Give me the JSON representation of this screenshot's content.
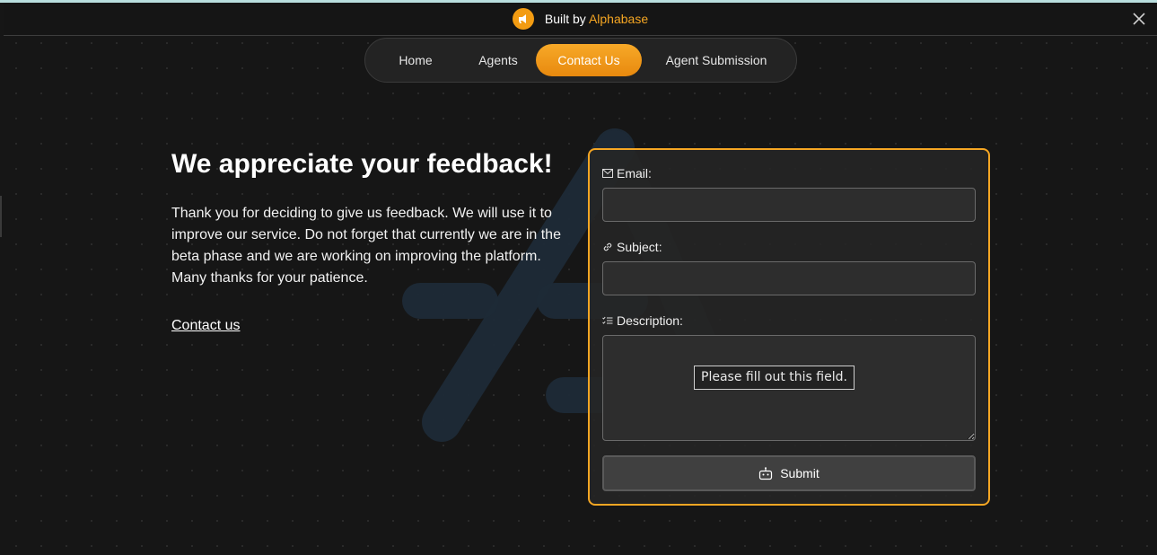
{
  "banner": {
    "prefix": "Built by",
    "brand": "Alphabase",
    "logo_icon": "megaphone-icon",
    "close_icon": "close-icon"
  },
  "nav": {
    "items": [
      {
        "label": "Home"
      },
      {
        "label": "Agents"
      },
      {
        "label": "Contact Us",
        "active": true
      },
      {
        "label": "Agent Submission"
      }
    ]
  },
  "content": {
    "title": "We appreciate your feedback!",
    "description": "Thank you for deciding to give us feedback. We will use it to improve our service. Do not forget that currently we are in the beta phase and we are working on improving the platform. Many thanks for your patience.",
    "contact_link": "Contact us"
  },
  "form": {
    "email_label": "Email:",
    "email_value": "",
    "email_icon": "mail-icon",
    "subject_label": "Subject:",
    "subject_value": "",
    "subject_icon": "link-icon",
    "description_label": "Description:",
    "description_value": "",
    "description_icon": "list-check-icon",
    "validation_tooltip": "Please fill out this field.",
    "submit_label": "Submit",
    "submit_icon": "robot-icon"
  },
  "colors": {
    "accent": "#f5a623",
    "background": "#161616",
    "banner_top": "#b9dede"
  }
}
